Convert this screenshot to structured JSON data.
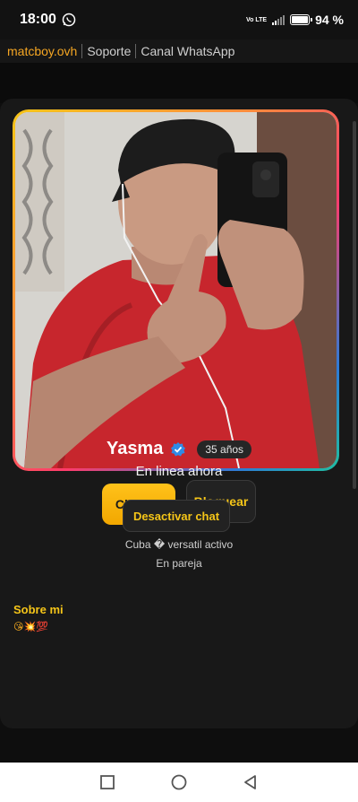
{
  "status": {
    "time": "18:00",
    "net_top": "Vo LTE",
    "net_bottom": "LTE",
    "battery": "94 %"
  },
  "nav": {
    "brand": "matcboy.ovh",
    "support": "Soporte",
    "whatsapp": "Canal WhatsApp"
  },
  "profile": {
    "chat_label": "Chatear",
    "block_label": "Bloquear",
    "name": "Yasma",
    "age": "35 años",
    "online": "En linea ahora",
    "deactivate_label": "Desactivar chat",
    "location": "Cuba � versatil activo",
    "relationship": "En pareja",
    "about_title": "Sobre mi",
    "about_text": "😘💥💯"
  },
  "colors": {
    "accent": "#f5c518",
    "brand": "#f5a623",
    "background": "#0e0e0e",
    "card": "#181818"
  },
  "icons": [
    "whatsapp-icon",
    "signal-icon",
    "battery-icon",
    "verified-icon",
    "square-icon",
    "circle-icon",
    "back-icon"
  ]
}
